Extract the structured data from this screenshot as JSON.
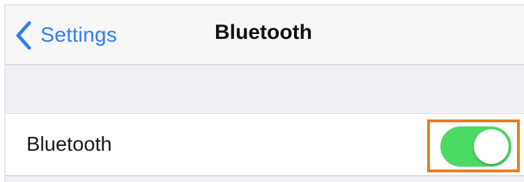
{
  "navbar": {
    "back_label": "Settings",
    "back_icon": "chevron-left-icon",
    "title": "Bluetooth"
  },
  "settings_row": {
    "label": "Bluetooth",
    "toggle_state": "on"
  },
  "colors": {
    "accent_blue": "#2f7cf6",
    "toggle_on_green": "#4cd964",
    "highlight_orange": "#ed7a1f",
    "grouped_background": "#efeff4"
  }
}
